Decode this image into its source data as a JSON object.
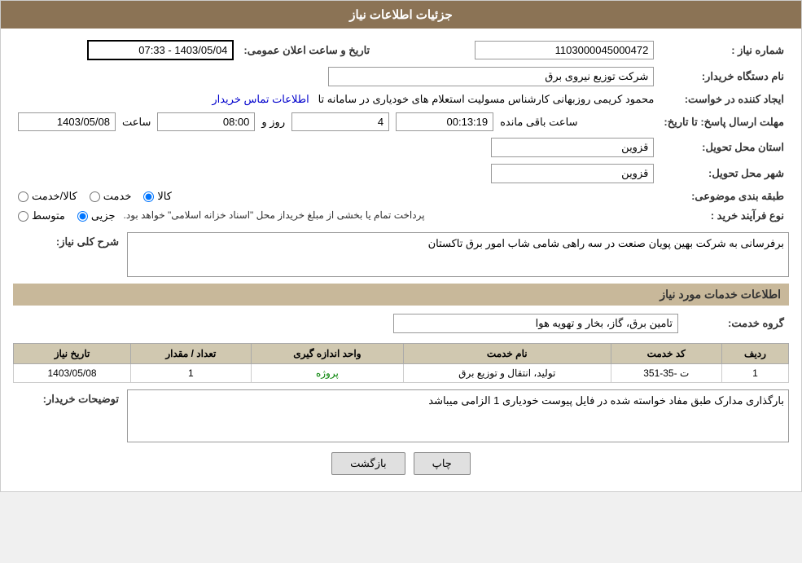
{
  "header": {
    "title": "جزئیات اطلاعات نیاز"
  },
  "fields": {
    "need_number_label": "شماره نیاز :",
    "need_number_value": "1103000045000472",
    "buyer_station_label": "نام دستگاه خریدار:",
    "buyer_station_value": "شرکت توزیع نیروی برق",
    "creator_label": "ایجاد کننده در خواست:",
    "creator_value": "محمود کریمی روزبهانی کارشناس  مسولیت استعلام های خودیاری در سامانه تا",
    "creator_link": "اطلاعات تماس خریدار",
    "send_date_label": "مهلت ارسال پاسخ: تا تاریخ:",
    "send_date_value": "1403/05/08",
    "send_time_label": "ساعت",
    "send_time_value": "08:00",
    "send_day_label": "روز و",
    "send_day_value": "4",
    "remaining_label": "ساعت باقی مانده",
    "remaining_value": "00:13:19",
    "announce_label": "تاریخ و ساعت اعلان عمومی:",
    "announce_value": "1403/05/04 - 07:33",
    "province_label": "استان محل تحویل:",
    "province_value": "قزوین",
    "city_label": "شهر محل تحویل:",
    "city_value": "قزوین",
    "category_label": "طبقه بندی موضوعی:",
    "category_options": [
      "کالا",
      "خدمت",
      "کالا/خدمت"
    ],
    "category_selected": "کالا",
    "purchase_type_label": "نوع فرآیند خرید :",
    "purchase_types": [
      "جزیی",
      "متوسط"
    ],
    "purchase_type_note": "پرداخت تمام یا بخشی از مبلغ خریداز محل \"اسناد خزانه اسلامی\" خواهد بود.",
    "description_label": "شرح کلی نیاز:",
    "description_value": "برفرسانی به شرکت بهین پویان صنعت در سه راهی شامی شاب امور برق تاکستان",
    "services_section": "اطلاعات خدمات مورد نیاز",
    "service_group_label": "گروه خدمت:",
    "service_group_value": "تامین برق، گاز، بخار و تهویه هوا",
    "table": {
      "columns": [
        "ردیف",
        "کد خدمت",
        "نام خدمت",
        "واحد اندازه گیری",
        "تعداد / مقدار",
        "تاریخ نیاز"
      ],
      "rows": [
        {
          "row": "1",
          "code": "ت -35-351",
          "name": "تولید، انتقال و توزیع برق",
          "unit": "پروژه",
          "qty": "1",
          "date": "1403/05/08"
        }
      ]
    },
    "buyer_notes_label": "توضیحات خریدار:",
    "buyer_notes_value": "بارگذاری مدارک طبق مفاد خواسته شده در فایل پیوست خودیاری 1 الزامی میباشد"
  },
  "buttons": {
    "print": "چاپ",
    "back": "بازگشت"
  }
}
